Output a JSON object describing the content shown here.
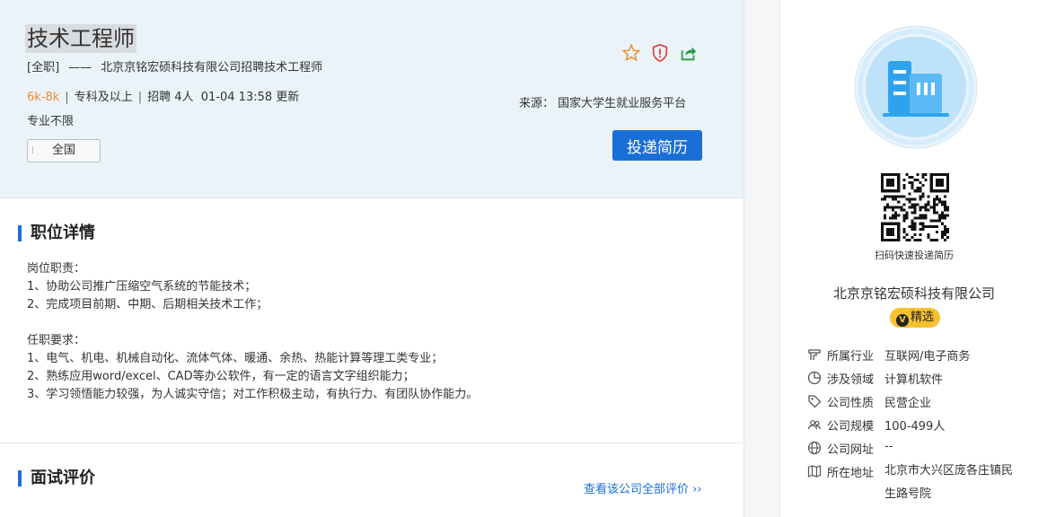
{
  "job": {
    "title": "技术工程师",
    "subtitle_type": "[全职]",
    "subtitle_dash": "——",
    "subtitle_company": "北京京铭宏硕科技有限公司招聘技术工程师",
    "salary": "6k-8k",
    "education": "专科及以上",
    "hiring": "招聘 4人",
    "updated": "01-04 13:58 更新",
    "sep": "|",
    "major": "专业不限",
    "location_tag": "全国",
    "source": "来源： 国家大学生就业服务平台",
    "apply_label": "投递简历"
  },
  "icons": [
    "star-icon",
    "shield-icon",
    "share-icon"
  ],
  "colors": {
    "accent": "#1a6fd6",
    "salary": "#f08c2b",
    "header_bg": "#eaf3f8",
    "badge": "#f5c12f"
  },
  "details": {
    "heading": "职位详情",
    "text": "岗位职责：\n1、协助公司推广压缩空气系统的节能技术；\n2、完成项目前期、中期、后期相关技术工作；\n\n任职要求：\n1、电气、机电、机械自动化、流体气体、暖通、余热、热能计算等理工类专业；\n2、熟练应用word/excel、CAD等办公软件，有一定的语言文字组织能力；\n3、学习领悟能力较强，为人诚实守信；对工作积极主动，有执行力、有团队协作能力。"
  },
  "reviews": {
    "heading": "面试评价",
    "link": "查看该公司全部评价 ››"
  },
  "company": {
    "qr_caption": "扫码快速投递简历",
    "name": "北京京铭宏硕科技有限公司",
    "badge": "精选",
    "badge_mark": "V",
    "info": [
      {
        "icon": "industry-icon",
        "label": "所属行业",
        "value": "互联网/电子商务"
      },
      {
        "icon": "pie-chart-icon",
        "label": "涉及领域",
        "value": "计算机软件"
      },
      {
        "icon": "tag-icon",
        "label": "公司性质",
        "value": "民营企业"
      },
      {
        "icon": "people-icon",
        "label": "公司规模",
        "value": "100-499人"
      },
      {
        "icon": "globe-icon",
        "label": "公司网址",
        "value": "--"
      },
      {
        "icon": "map-icon",
        "label": "所在地址",
        "value": "北京市大兴区庞各庄镇民生路号院"
      }
    ]
  }
}
